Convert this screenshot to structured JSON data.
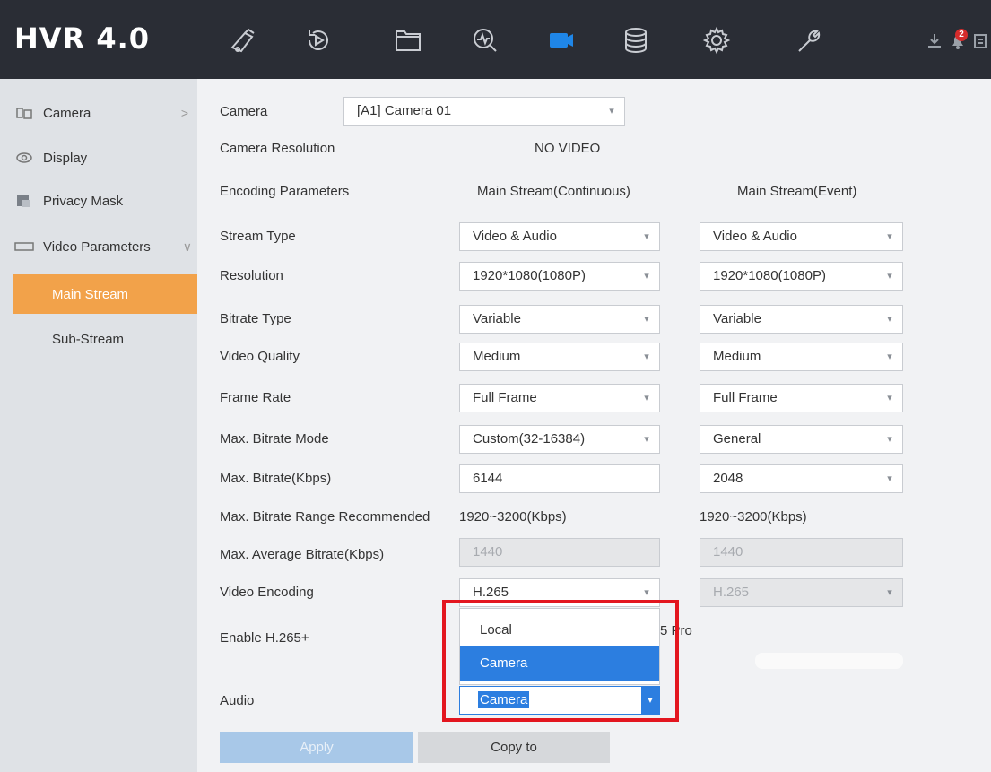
{
  "app": {
    "title": "HVR 4.0"
  },
  "topbar": {
    "alarm_count": "2"
  },
  "sidebar": {
    "items": [
      {
        "label": "Camera",
        "chevron": ">"
      },
      {
        "label": "Display"
      },
      {
        "label": "Privacy Mask"
      },
      {
        "label": "Video Parameters",
        "chevron": "∨"
      }
    ],
    "sub_items": [
      {
        "label": "Main Stream",
        "active": true
      },
      {
        "label": "Sub-Stream"
      }
    ]
  },
  "form": {
    "camera_label": "Camera",
    "camera_value": "[A1] Camera 01",
    "resolution_label": "Camera Resolution",
    "resolution_value": "NO VIDEO",
    "encoding_label": "Encoding Parameters",
    "col1_header": "Main Stream(Continuous)",
    "col2_header": "Main Stream(Event)",
    "rows": [
      {
        "label": "Stream Type",
        "col1": "Video & Audio",
        "col2": "Video & Audio"
      },
      {
        "label": "Resolution",
        "col1": "1920*1080(1080P)",
        "col2": "1920*1080(1080P)"
      },
      {
        "label": "Bitrate Type",
        "col1": "Variable",
        "col2": "Variable"
      },
      {
        "label": "Video Quality",
        "col1": "Medium",
        "col2": "Medium"
      },
      {
        "label": "Frame Rate",
        "col1": "Full Frame",
        "col2": "Full Frame"
      },
      {
        "label": "Max. Bitrate Mode",
        "col1": "Custom(32-16384)",
        "col2": "General"
      },
      {
        "label": "Max. Bitrate(Kbps)",
        "col1": "6144",
        "col2": "2048"
      }
    ],
    "range_label": "Max. Bitrate Range Recommended",
    "range_col1": "1920~3200(Kbps)",
    "range_col2": "1920~3200(Kbps)",
    "avg_label": "Max. Average Bitrate(Kbps)",
    "avg_col1": "1440",
    "avg_col2": "1440",
    "encoding_video_label": "Video Encoding",
    "encoding_video_col1": "H.265",
    "encoding_video_col2": "H.265",
    "h265_label": "Enable H.265+",
    "h265_partial_text": "5 Pro",
    "audio_label": "Audio",
    "audio_value": "Camera",
    "dropdown_options": [
      "Local",
      "Camera"
    ]
  },
  "buttons": {
    "apply": "Apply",
    "copy": "Copy to"
  }
}
